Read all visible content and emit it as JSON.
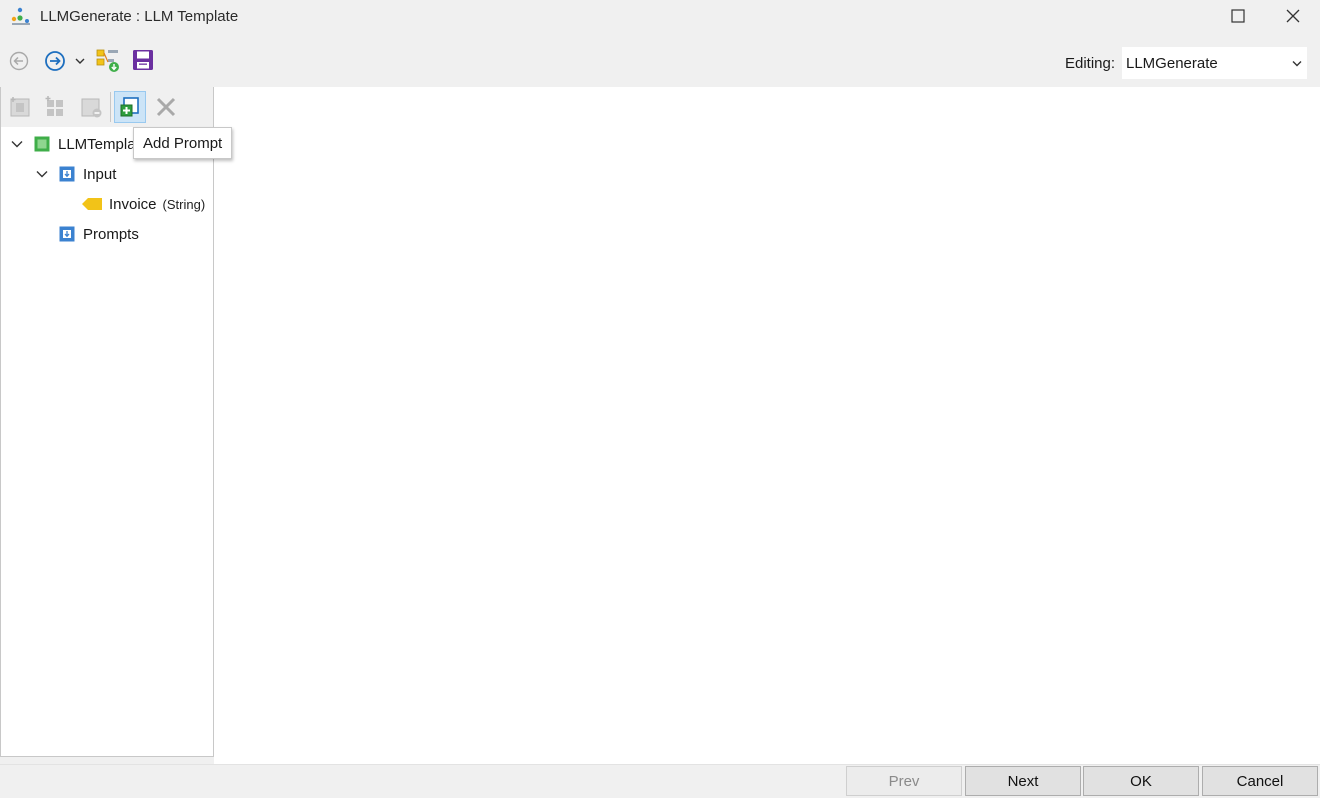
{
  "window": {
    "title": "LLMGenerate : LLM Template",
    "icons": {
      "logo": "app-logo-icon",
      "maximize": "maximize-icon",
      "close": "close-icon"
    }
  },
  "toolbar": {
    "back_icon": "back-arrow-circle-icon",
    "forward_icon": "forward-arrow-circle-icon",
    "forward_menu_icon": "chevron-down-icon",
    "properties_icon": "properties-download-icon",
    "save_icon": "save-disk-icon",
    "editing_label": "Editing:",
    "editing_value": "LLMGenerate"
  },
  "tree_toolbar": {
    "buttons": [
      {
        "name": "add-child",
        "icon": "add-node-icon",
        "enabled": false
      },
      {
        "name": "add-group",
        "icon": "add-group-icon",
        "enabled": false
      },
      {
        "name": "remove-node",
        "icon": "remove-node-icon",
        "enabled": false
      },
      {
        "name": "add-prompt",
        "icon": "add-prompt-icon",
        "enabled": true
      },
      {
        "name": "delete",
        "icon": "delete-x-icon",
        "enabled": false
      }
    ],
    "tooltip": "Add Prompt"
  },
  "tree": {
    "root": {
      "label": "LLMTemplate",
      "expanded": true
    },
    "input": {
      "label": "Input",
      "expanded": true
    },
    "invoice": {
      "label": "Invoice",
      "type": "(String)"
    },
    "prompts": {
      "label": "Prompts"
    }
  },
  "footer": {
    "prev": "Prev",
    "next": "Next",
    "ok": "OK",
    "cancel": "Cancel"
  },
  "colors": {
    "accent_blue": "#1e6fbf",
    "save_purple": "#6b2fa0",
    "tree_green": "#3fae49",
    "tree_blue": "#3b82d0",
    "tag_yellow": "#f2c318",
    "add_prompt_green": "#2e9e3e"
  }
}
